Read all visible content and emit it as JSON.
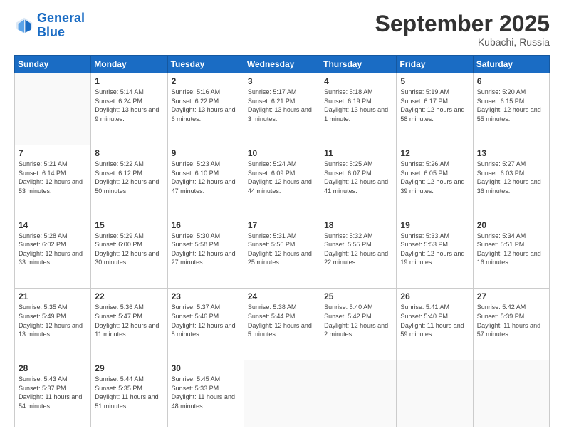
{
  "logo": {
    "line1": "General",
    "line2": "Blue"
  },
  "title": "September 2025",
  "location": "Kubachi, Russia",
  "days_header": [
    "Sunday",
    "Monday",
    "Tuesday",
    "Wednesday",
    "Thursday",
    "Friday",
    "Saturday"
  ],
  "weeks": [
    [
      {
        "num": "",
        "sunrise": "",
        "sunset": "",
        "daylight": ""
      },
      {
        "num": "1",
        "sunrise": "Sunrise: 5:14 AM",
        "sunset": "Sunset: 6:24 PM",
        "daylight": "Daylight: 13 hours and 9 minutes."
      },
      {
        "num": "2",
        "sunrise": "Sunrise: 5:16 AM",
        "sunset": "Sunset: 6:22 PM",
        "daylight": "Daylight: 13 hours and 6 minutes."
      },
      {
        "num": "3",
        "sunrise": "Sunrise: 5:17 AM",
        "sunset": "Sunset: 6:21 PM",
        "daylight": "Daylight: 13 hours and 3 minutes."
      },
      {
        "num": "4",
        "sunrise": "Sunrise: 5:18 AM",
        "sunset": "Sunset: 6:19 PM",
        "daylight": "Daylight: 13 hours and 1 minute."
      },
      {
        "num": "5",
        "sunrise": "Sunrise: 5:19 AM",
        "sunset": "Sunset: 6:17 PM",
        "daylight": "Daylight: 12 hours and 58 minutes."
      },
      {
        "num": "6",
        "sunrise": "Sunrise: 5:20 AM",
        "sunset": "Sunset: 6:15 PM",
        "daylight": "Daylight: 12 hours and 55 minutes."
      }
    ],
    [
      {
        "num": "7",
        "sunrise": "Sunrise: 5:21 AM",
        "sunset": "Sunset: 6:14 PM",
        "daylight": "Daylight: 12 hours and 53 minutes."
      },
      {
        "num": "8",
        "sunrise": "Sunrise: 5:22 AM",
        "sunset": "Sunset: 6:12 PM",
        "daylight": "Daylight: 12 hours and 50 minutes."
      },
      {
        "num": "9",
        "sunrise": "Sunrise: 5:23 AM",
        "sunset": "Sunset: 6:10 PM",
        "daylight": "Daylight: 12 hours and 47 minutes."
      },
      {
        "num": "10",
        "sunrise": "Sunrise: 5:24 AM",
        "sunset": "Sunset: 6:09 PM",
        "daylight": "Daylight: 12 hours and 44 minutes."
      },
      {
        "num": "11",
        "sunrise": "Sunrise: 5:25 AM",
        "sunset": "Sunset: 6:07 PM",
        "daylight": "Daylight: 12 hours and 41 minutes."
      },
      {
        "num": "12",
        "sunrise": "Sunrise: 5:26 AM",
        "sunset": "Sunset: 6:05 PM",
        "daylight": "Daylight: 12 hours and 39 minutes."
      },
      {
        "num": "13",
        "sunrise": "Sunrise: 5:27 AM",
        "sunset": "Sunset: 6:03 PM",
        "daylight": "Daylight: 12 hours and 36 minutes."
      }
    ],
    [
      {
        "num": "14",
        "sunrise": "Sunrise: 5:28 AM",
        "sunset": "Sunset: 6:02 PM",
        "daylight": "Daylight: 12 hours and 33 minutes."
      },
      {
        "num": "15",
        "sunrise": "Sunrise: 5:29 AM",
        "sunset": "Sunset: 6:00 PM",
        "daylight": "Daylight: 12 hours and 30 minutes."
      },
      {
        "num": "16",
        "sunrise": "Sunrise: 5:30 AM",
        "sunset": "Sunset: 5:58 PM",
        "daylight": "Daylight: 12 hours and 27 minutes."
      },
      {
        "num": "17",
        "sunrise": "Sunrise: 5:31 AM",
        "sunset": "Sunset: 5:56 PM",
        "daylight": "Daylight: 12 hours and 25 minutes."
      },
      {
        "num": "18",
        "sunrise": "Sunrise: 5:32 AM",
        "sunset": "Sunset: 5:55 PM",
        "daylight": "Daylight: 12 hours and 22 minutes."
      },
      {
        "num": "19",
        "sunrise": "Sunrise: 5:33 AM",
        "sunset": "Sunset: 5:53 PM",
        "daylight": "Daylight: 12 hours and 19 minutes."
      },
      {
        "num": "20",
        "sunrise": "Sunrise: 5:34 AM",
        "sunset": "Sunset: 5:51 PM",
        "daylight": "Daylight: 12 hours and 16 minutes."
      }
    ],
    [
      {
        "num": "21",
        "sunrise": "Sunrise: 5:35 AM",
        "sunset": "Sunset: 5:49 PM",
        "daylight": "Daylight: 12 hours and 13 minutes."
      },
      {
        "num": "22",
        "sunrise": "Sunrise: 5:36 AM",
        "sunset": "Sunset: 5:47 PM",
        "daylight": "Daylight: 12 hours and 11 minutes."
      },
      {
        "num": "23",
        "sunrise": "Sunrise: 5:37 AM",
        "sunset": "Sunset: 5:46 PM",
        "daylight": "Daylight: 12 hours and 8 minutes."
      },
      {
        "num": "24",
        "sunrise": "Sunrise: 5:38 AM",
        "sunset": "Sunset: 5:44 PM",
        "daylight": "Daylight: 12 hours and 5 minutes."
      },
      {
        "num": "25",
        "sunrise": "Sunrise: 5:40 AM",
        "sunset": "Sunset: 5:42 PM",
        "daylight": "Daylight: 12 hours and 2 minutes."
      },
      {
        "num": "26",
        "sunrise": "Sunrise: 5:41 AM",
        "sunset": "Sunset: 5:40 PM",
        "daylight": "Daylight: 11 hours and 59 minutes."
      },
      {
        "num": "27",
        "sunrise": "Sunrise: 5:42 AM",
        "sunset": "Sunset: 5:39 PM",
        "daylight": "Daylight: 11 hours and 57 minutes."
      }
    ],
    [
      {
        "num": "28",
        "sunrise": "Sunrise: 5:43 AM",
        "sunset": "Sunset: 5:37 PM",
        "daylight": "Daylight: 11 hours and 54 minutes."
      },
      {
        "num": "29",
        "sunrise": "Sunrise: 5:44 AM",
        "sunset": "Sunset: 5:35 PM",
        "daylight": "Daylight: 11 hours and 51 minutes."
      },
      {
        "num": "30",
        "sunrise": "Sunrise: 5:45 AM",
        "sunset": "Sunset: 5:33 PM",
        "daylight": "Daylight: 11 hours and 48 minutes."
      },
      {
        "num": "",
        "sunrise": "",
        "sunset": "",
        "daylight": ""
      },
      {
        "num": "",
        "sunrise": "",
        "sunset": "",
        "daylight": ""
      },
      {
        "num": "",
        "sunrise": "",
        "sunset": "",
        "daylight": ""
      },
      {
        "num": "",
        "sunrise": "",
        "sunset": "",
        "daylight": ""
      }
    ]
  ]
}
